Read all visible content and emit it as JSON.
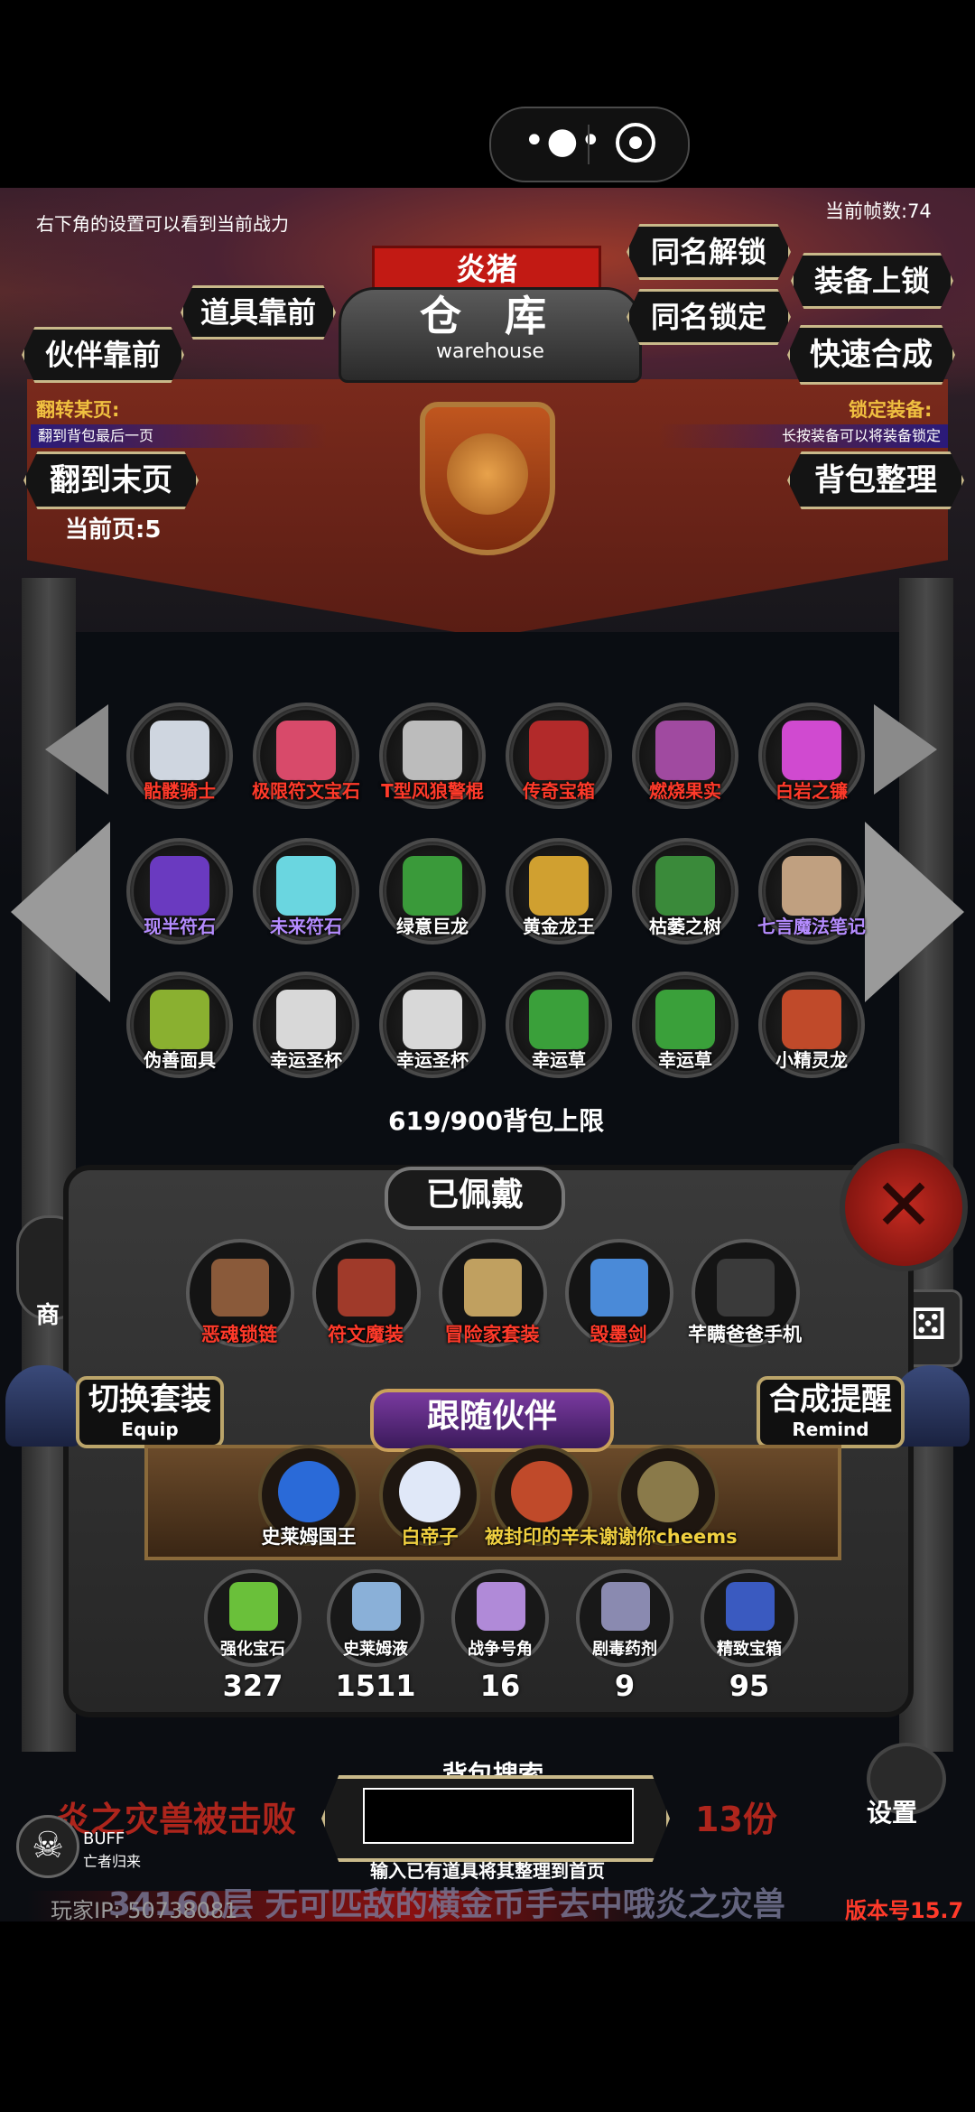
{
  "capsule": {
    "more_icon": "more-dots-icon",
    "close_icon": "target-circle-icon"
  },
  "hint_top_left": "右下角的设置可以看到当前战力",
  "fps": "当前帧数:74",
  "player_name": "炎猪",
  "warehouse": {
    "title_zh": "仓 库",
    "title_en": "warehouse"
  },
  "buttons": {
    "partner_front": "伙伴靠前",
    "item_front": "道具靠前",
    "unlock_same": "同名解锁",
    "lock_same": "同名锁定",
    "equip_lock": "装备上锁",
    "fast_merge": "快速合成",
    "go_last": "翻到末页",
    "sort_bag": "背包整理"
  },
  "flip": {
    "label": "翻转某页:",
    "sub": "翻到背包最后一页"
  },
  "lock": {
    "label": "锁定装备:",
    "sub": "长按装备可以将装备锁定"
  },
  "current_page": "当前页:5",
  "grid_items": [
    {
      "name": "骷髅骑士",
      "color": "#ff3a2a",
      "icon": "#cfd6e0"
    },
    {
      "name": "极限符文宝石",
      "color": "#ff3a2a",
      "icon": "#d84a6a"
    },
    {
      "name": "T型风狼警棍",
      "color": "#ff3a2a",
      "icon": "#bcbcbc"
    },
    {
      "name": "传奇宝箱",
      "color": "#ff3a2a",
      "icon": "#b22a2a"
    },
    {
      "name": "燃烧果实",
      "color": "#ff3a2a",
      "icon": "#a04aa0"
    },
    {
      "name": "白岩之镰",
      "color": "#ff3a2a",
      "icon": "#d04ad0"
    },
    {
      "name": "现半符石",
      "color": "#b58cff",
      "icon": "#6a3ac0"
    },
    {
      "name": "未来符石",
      "color": "#b58cff",
      "icon": "#6ad6e0"
    },
    {
      "name": "绿意巨龙",
      "color": "#ffffff",
      "icon": "#3a9a3a"
    },
    {
      "name": "黄金龙王",
      "color": "#ffffff",
      "icon": "#d0a030"
    },
    {
      "name": "枯萎之树",
      "color": "#ffffff",
      "icon": "#3a8a3a"
    },
    {
      "name": "七言魔法笔记",
      "color": "#b58cff",
      "icon": "#c0a080"
    },
    {
      "name": "伪善面具",
      "color": "#ffffff",
      "icon": "#8ab030"
    },
    {
      "name": "幸运圣杯",
      "color": "#ffffff",
      "icon": "#d8d8d8"
    },
    {
      "name": "幸运圣杯",
      "color": "#ffffff",
      "icon": "#d8d8d8"
    },
    {
      "name": "幸运草",
      "color": "#ffffff",
      "icon": "#3aa03a"
    },
    {
      "name": "幸运草",
      "color": "#ffffff",
      "icon": "#3aa03a"
    },
    {
      "name": "小精灵龙",
      "color": "#ffffff",
      "icon": "#c04a2a"
    }
  ],
  "bag_capacity": "619/900背包上限",
  "worn": {
    "title": "已佩戴",
    "items": [
      {
        "name": "恶魂锁链",
        "color": "#ff3a2a",
        "icon": "#8a5a3a"
      },
      {
        "name": "符文魔装",
        "color": "#ff3a2a",
        "icon": "#a03a2a"
      },
      {
        "name": "冒险家套装",
        "color": "#ff3a2a",
        "icon": "#c0a060"
      },
      {
        "name": "毁墨剑",
        "color": "#ff3a2a",
        "icon": "#4a8ad8"
      },
      {
        "name": "芊瞒爸爸手机",
        "color": "#ffffff",
        "icon": "#3a3a3a"
      }
    ]
  },
  "switch_set": {
    "title": "切换套装",
    "sub": "Equip"
  },
  "merge_remind": {
    "title": "合成提醒",
    "sub": "Remind"
  },
  "follow": {
    "title": "跟随伙伴",
    "partners": [
      {
        "name": "史莱姆国王",
        "color": "#ffffff",
        "icon": "#2a6ad8"
      },
      {
        "name": "白帝子",
        "color": "#f0d040",
        "icon": "#e0e8f8"
      },
      {
        "name": "被封印的辛未",
        "color": "#f0d040",
        "icon": "#c04a2a"
      },
      {
        "name": "谢谢你cheems",
        "color": "#f0d040",
        "icon": "#8a7a4a"
      }
    ]
  },
  "materials": [
    {
      "name": "强化宝石",
      "count": "327",
      "icon": "#6ac03a"
    },
    {
      "name": "史莱姆液",
      "count": "1511",
      "icon": "#8ab0d8"
    },
    {
      "name": "战争号角",
      "count": "16",
      "icon": "#b08ad8"
    },
    {
      "name": "剧毒药剂",
      "count": "9",
      "icon": "#8a8ab0"
    },
    {
      "name": "精致宝箱",
      "count": "95",
      "icon": "#3a5ac0"
    }
  ],
  "search": {
    "label": "背包搜索",
    "placeholder": "",
    "hint": "输入已有道具将其整理到首页"
  },
  "news": {
    "line1": "炎之灾兽被击败",
    "line1_tail": "13份",
    "line2": "34160层 无可匹敌的横金币手去中哦炎之灾兽"
  },
  "player_ip": "玩家IP: 50738081",
  "version": "版本号15.7",
  "settings_label": "设置",
  "buff": {
    "label": "BUFF",
    "sub": "亡者归来"
  },
  "shop_label": "商"
}
